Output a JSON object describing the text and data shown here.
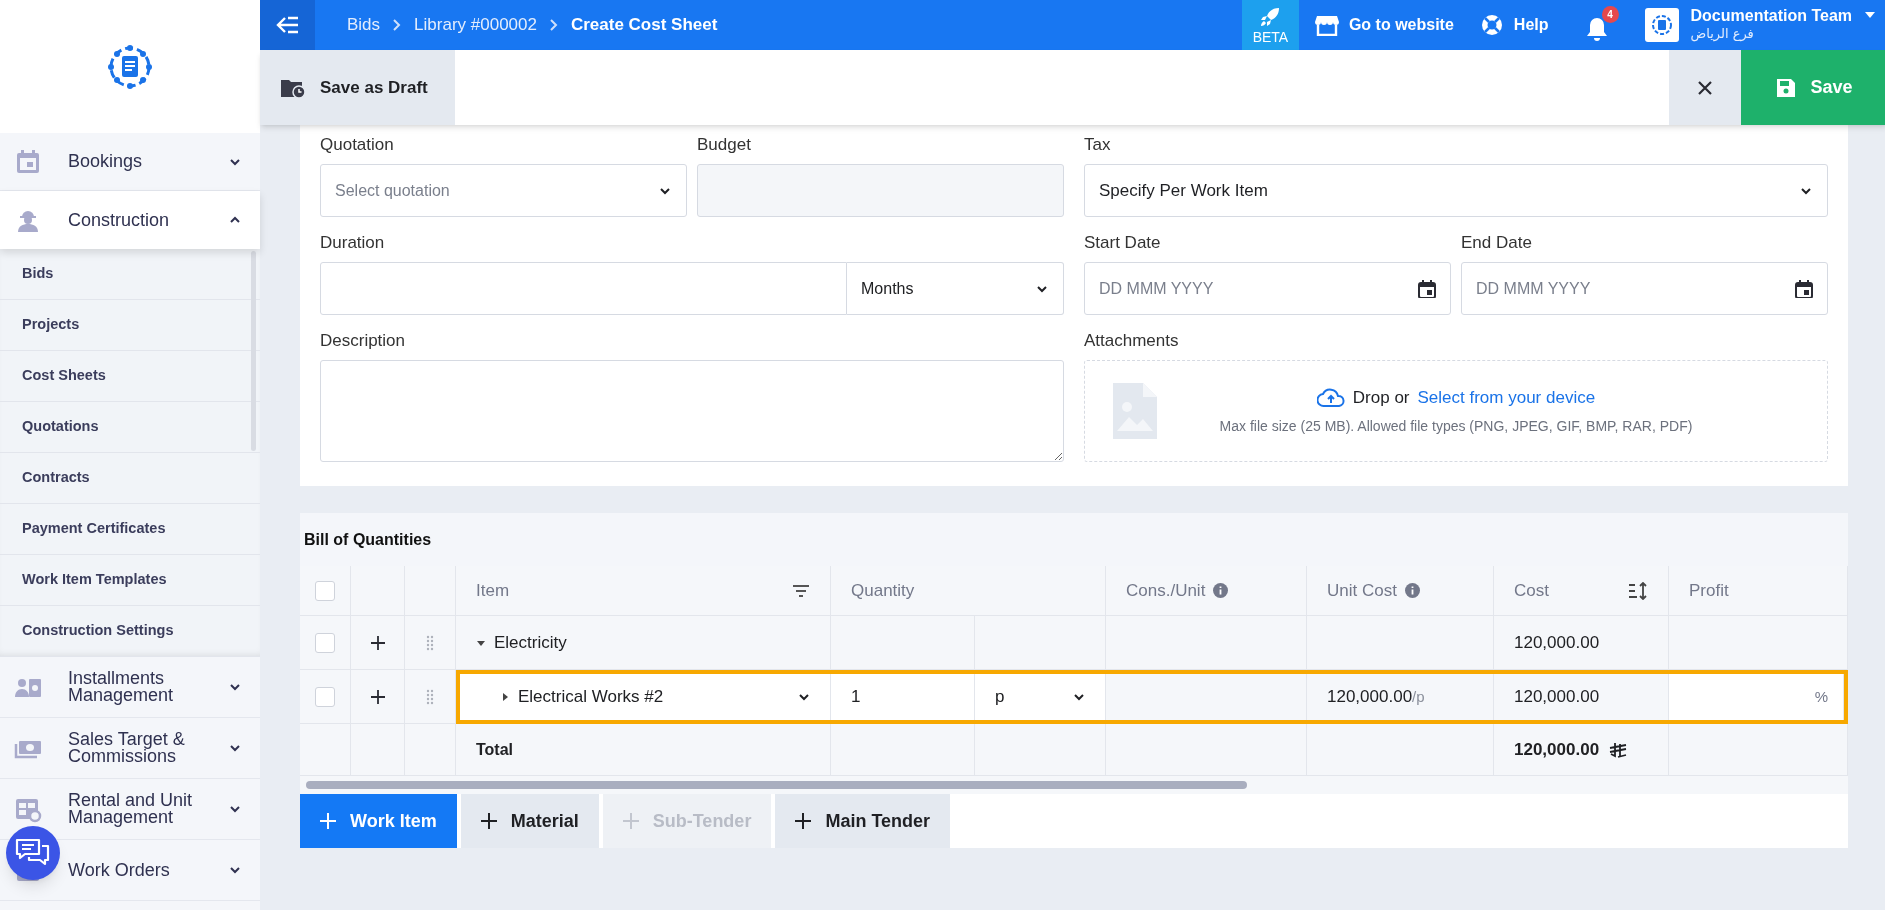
{
  "sidebar": {
    "items": [
      {
        "label": "Bookings",
        "expanded": false
      },
      {
        "label": "Construction",
        "expanded": true,
        "children": [
          "Bids",
          "Projects",
          "Cost Sheets",
          "Quotations",
          "Contracts",
          "Payment Certificates",
          "Work Item Templates",
          "Construction Settings"
        ]
      },
      {
        "label": "Installments Management",
        "expanded": false
      },
      {
        "label": "Sales Target & Commissions",
        "expanded": false
      },
      {
        "label": "Rental and Unit Management",
        "expanded": false
      },
      {
        "label": "Work Orders",
        "expanded": false
      }
    ]
  },
  "topbar": {
    "breadcrumbs": [
      "Bids",
      "Library #000002",
      "Create Cost Sheet"
    ],
    "beta": "BETA",
    "website": "Go to website",
    "help": "Help",
    "notifications": "4",
    "user": "Documentation Team",
    "branch": "فرع الرياض"
  },
  "toolbar": {
    "draft": "Save as Draft",
    "save": "Save"
  },
  "form": {
    "rows": [
      {
        "left": [
          {
            "kind": "select",
            "label": "Quotation",
            "placeholder": "Select quotation"
          },
          {
            "kind": "readonly",
            "label": "Budget"
          }
        ],
        "right": [
          {
            "kind": "select",
            "label": "Tax",
            "value": "Specify Per Work Item"
          }
        ]
      },
      {
        "left": [
          {
            "kind": "duration",
            "label": "Duration",
            "unit": "Months"
          }
        ],
        "right": [
          {
            "kind": "date",
            "label": "Start Date",
            "placeholder": "DD MMM YYYY"
          },
          {
            "kind": "date",
            "label": "End Date",
            "placeholder": "DD MMM YYYY"
          }
        ]
      },
      {
        "left": [
          {
            "kind": "textarea",
            "label": "Description"
          }
        ],
        "right": [
          {
            "kind": "upload",
            "label": "Attachments",
            "prompt": "Drop or",
            "link": "Select from your device",
            "hint": "Max file size (25 MB). Allowed file types (PNG, JPEG, GIF, BMP, RAR, PDF)"
          }
        ]
      }
    ]
  },
  "bill": {
    "title": "Bill of Quantities",
    "all_checked": false,
    "columns": [
      {
        "label": "Item",
        "info": false
      },
      {
        "label": "Quantity",
        "info": false
      },
      {
        "label": "Cons./Unit",
        "info": true
      },
      {
        "label": "Unit Cost",
        "info": true
      },
      {
        "label": "Cost",
        "info": false
      },
      {
        "label": "Profit",
        "info": false
      }
    ],
    "rows": [
      {
        "kind": "group",
        "checked": false,
        "highlighted": false,
        "expanded": true,
        "item": "Electricity",
        "cost": "120,000.00"
      },
      {
        "kind": "item",
        "checked": false,
        "highlighted": true,
        "expanded": false,
        "item": "Electrical Works #2",
        "quantity": "1",
        "unit": "p",
        "unit_cost": "120,000.00",
        "unit_suffix": "/p",
        "cost": "120,000.00",
        "profit_suffix": "%"
      }
    ],
    "total": {
      "label": "Total",
      "cost": "120,000.00"
    },
    "buttons": [
      {
        "label": "Work Item",
        "kind": "primary",
        "disabled": false
      },
      {
        "label": "Material",
        "kind": "secondary",
        "disabled": false
      },
      {
        "label": "Sub-Tender",
        "kind": "secondary",
        "disabled": true
      },
      {
        "label": "Main Tender",
        "kind": "secondary",
        "disabled": false
      }
    ]
  }
}
